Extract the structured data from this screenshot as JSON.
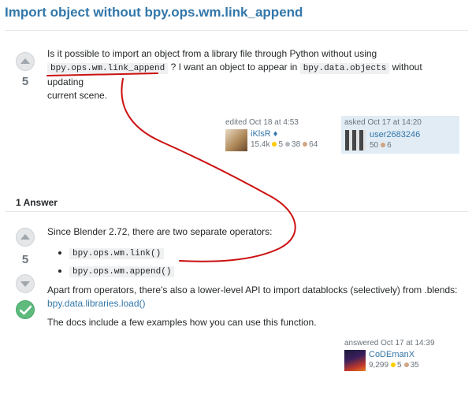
{
  "question": {
    "title": "Import object without bpy.ops.wm.link_append",
    "score": "5",
    "body": {
      "part1": "Is it possible to import an object from a library file through Python without using",
      "code1": "bpy.ops.wm.link_append",
      "part2": "? I want an object to appear in",
      "code2": "bpy.data.objects",
      "part3": "without updating",
      "part4": "current scene."
    },
    "edited": {
      "label": "edited Oct 18 at 4:53",
      "user": "iKlsR ♦",
      "rep": "15.4k",
      "gold": "5",
      "silver": "38",
      "bronze": "64"
    },
    "asked": {
      "label": "asked Oct 17 at 14:20",
      "user": "user2683246",
      "rep": "50",
      "bronze": "6"
    }
  },
  "answers_header": "1 Answer",
  "answer": {
    "score": "5",
    "intro": "Since Blender 2.72, there are two separate operators:",
    "operators": [
      "bpy.ops.wm.link()",
      "bpy.ops.wm.append()"
    ],
    "para2": "Apart from operators, there's also a lower-level API to import datablocks (selectively) from .blends:",
    "api_link": "bpy.data.libraries.load()",
    "para3": "The docs include a few examples how you can use this function.",
    "answered": {
      "label": "answered Oct 17 at 14:39",
      "user": "CoDEmanX",
      "rep": "9,299",
      "gold": "5",
      "bronze": "35"
    }
  },
  "colors": {
    "link": "#3377aa",
    "annotation": "#cc1111",
    "accepted": "#5eba7d",
    "owner_card": "#e1ecf4"
  }
}
